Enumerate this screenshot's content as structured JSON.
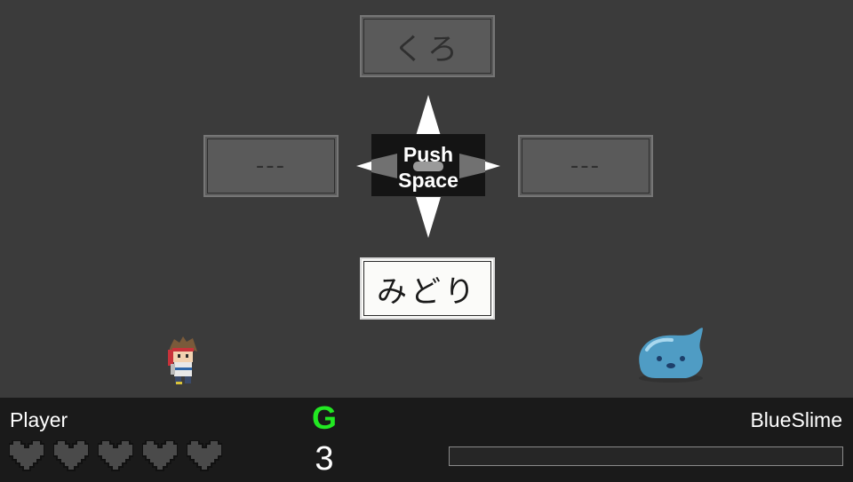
{
  "choices": {
    "top": "くろ",
    "left": "---",
    "right": "---",
    "bottom": "みどり",
    "selected": "bottom"
  },
  "prompt": {
    "line1": "Push",
    "line2": "Space"
  },
  "player": {
    "name": "Player",
    "hearts_total": 5,
    "hearts_filled": 0
  },
  "enemy": {
    "name": "BlueSlime",
    "hp_fraction": 0
  },
  "center": {
    "grade": "G",
    "count": "3"
  },
  "colors": {
    "grade": "#22e822",
    "selected_bg": "#fbfbf9",
    "choice_bg": "#5a5a5a"
  }
}
